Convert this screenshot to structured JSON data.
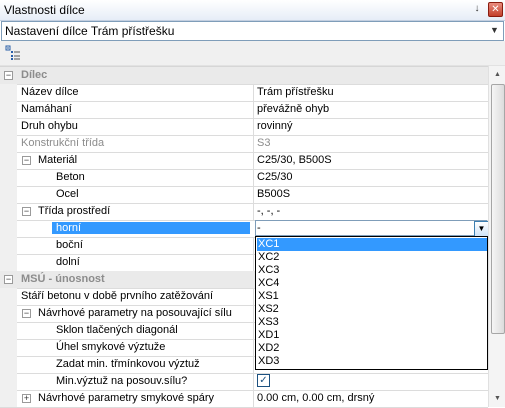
{
  "window": {
    "title": "Vlastnosti dílce",
    "pin_icon": "pin-icon",
    "close_icon": "close-icon"
  },
  "object_selector": {
    "value": "Nastavení dílce Trám přístřešku",
    "icon": "chevron-down-icon"
  },
  "toolbar": {
    "icon": "categorized-view-icon"
  },
  "sections": {
    "dilec": {
      "label": "Dílec"
    },
    "msu": {
      "label": "MSÚ - únosnost"
    }
  },
  "rows": [
    {
      "label": "Název dílce",
      "value": "Trám přístřešku"
    },
    {
      "label": "Namáhaní",
      "value": "převážně ohyb"
    },
    {
      "label": "Druh ohybu",
      "value": "rovinný"
    },
    {
      "label": "Konstrukční třída",
      "value": "S3"
    },
    {
      "label": "Materiál",
      "value": "C25/30, B500S"
    },
    {
      "label": "Beton",
      "value": "C25/30"
    },
    {
      "label": "Ocel",
      "value": "B500S"
    },
    {
      "label": "Třída prostředí",
      "value": "-, -, -"
    },
    {
      "label": "horní",
      "value": "-"
    },
    {
      "label": "boční",
      "value": ""
    },
    {
      "label": "dolní",
      "value": ""
    },
    {
      "label": "Stáří betonu v době prvního zatěžování",
      "value": ""
    },
    {
      "label": "Návrhové parametry na posouvající sílu",
      "value": ""
    },
    {
      "label": "Sklon tlačených diagonál",
      "value": ""
    },
    {
      "label": "Úhel smykové výztuže",
      "value": ""
    },
    {
      "label": "Zadat min. třmínkovou výztuž",
      "value": ""
    },
    {
      "label": "Min.výztuž na posouv.sílu?",
      "value": ""
    },
    {
      "label": "Návrhové parametry smykové spáry",
      "value": "0.00 cm, 0.00 cm, drsný"
    }
  ],
  "dropdown": {
    "options": [
      "XC1",
      "XC2",
      "XC3",
      "XC4",
      "XS1",
      "XS2",
      "XS3",
      "XD1",
      "XD2",
      "XD3"
    ],
    "highlighted": "XC1"
  },
  "colors": {
    "selection": "#3399ff",
    "category_bg": "#eaeaea",
    "category_text": "#8c8c8c"
  }
}
